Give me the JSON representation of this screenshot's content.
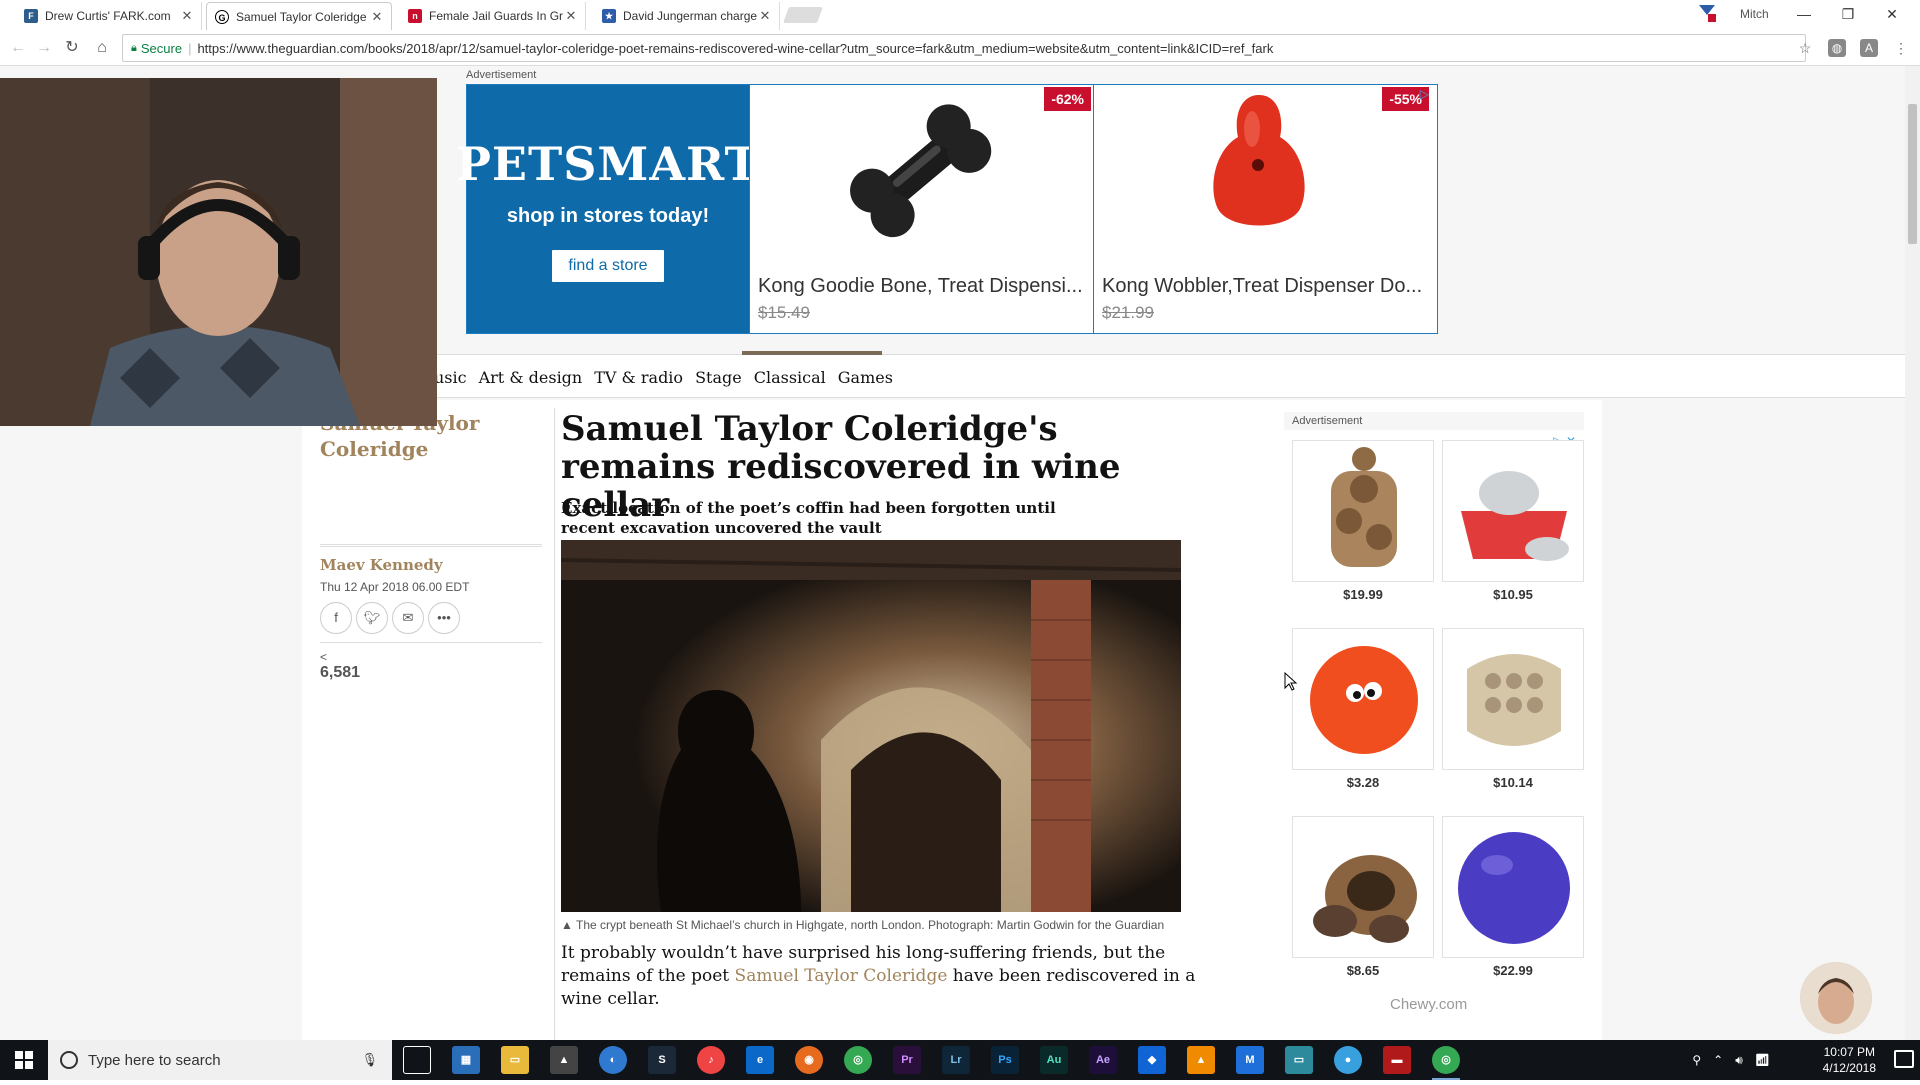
{
  "browser": {
    "tabs": [
      {
        "label": "Drew Curtis' FARK.com",
        "favicon": "fark-icon"
      },
      {
        "label": "Samuel Taylor Coleridge",
        "favicon": "guardian-icon",
        "active": true
      },
      {
        "label": "Female Jail Guards In Gr",
        "favicon": "news-icon"
      },
      {
        "label": "David Jungerman charge",
        "favicon": "star-news-icon"
      }
    ],
    "profile_name": "Mitch",
    "secure_label": "Secure",
    "url": "https://www.theguardian.com/books/2018/apr/12/samuel-taylor-coleridge-poet-remains-rediscovered-wine-cellar?utm_source=fark&utm_medium=website&utm_content=link&ICID=ref_fark"
  },
  "top_ad": {
    "label": "Advertisement",
    "brand": "PETSMART",
    "tagline": "shop in stores today!",
    "cta": "find a store",
    "products": [
      {
        "name": "Kong Goodie Bone, Treat Dispensi...",
        "price": "$15.49",
        "discount": "-62%"
      },
      {
        "name": "Kong Wobbler,Treat Dispenser Do...",
        "price": "$21.99",
        "discount": "-55%"
      }
    ]
  },
  "nav": {
    "items": [
      "usic",
      "Art & design",
      "TV & radio",
      "Stage",
      "Classical",
      "Games"
    ]
  },
  "article": {
    "kicker": "Samuel Taylor Coleridge",
    "author": "Maev Kennedy",
    "date": "Thu 12 Apr 2018 06.00 EDT",
    "share_count": "6,581",
    "headline": "Samuel Taylor Coleridge's remains rediscovered in wine cellar",
    "standfirst": "Exact location of the poet’s coffin had been forgotten until recent excavation uncovered the vault",
    "caption": "The crypt beneath St Michael’s church in Highgate, north London. Photograph: Martin Godwin for the Guardian",
    "body_start": "It probably wouldn’t have surprised his long-suffering friends, but the remains of the poet ",
    "body_link": "Samuel Taylor Coleridge",
    "body_end": " have been rediscovered in a wine cellar."
  },
  "right_ad": {
    "label": "Advertisement",
    "prices": [
      "$19.99",
      "$10.95",
      "$3.28",
      "$10.14",
      "$8.65",
      "$22.99"
    ],
    "brand": "Chewy.com"
  },
  "taskbar": {
    "search_placeholder": "Type here to search",
    "time": "10:07 PM",
    "date": "4/12/2018"
  },
  "colors": {
    "guardian_accent": "#a1845c",
    "petsmart_blue": "#0e6aa8",
    "discount_red": "#c8102e"
  }
}
